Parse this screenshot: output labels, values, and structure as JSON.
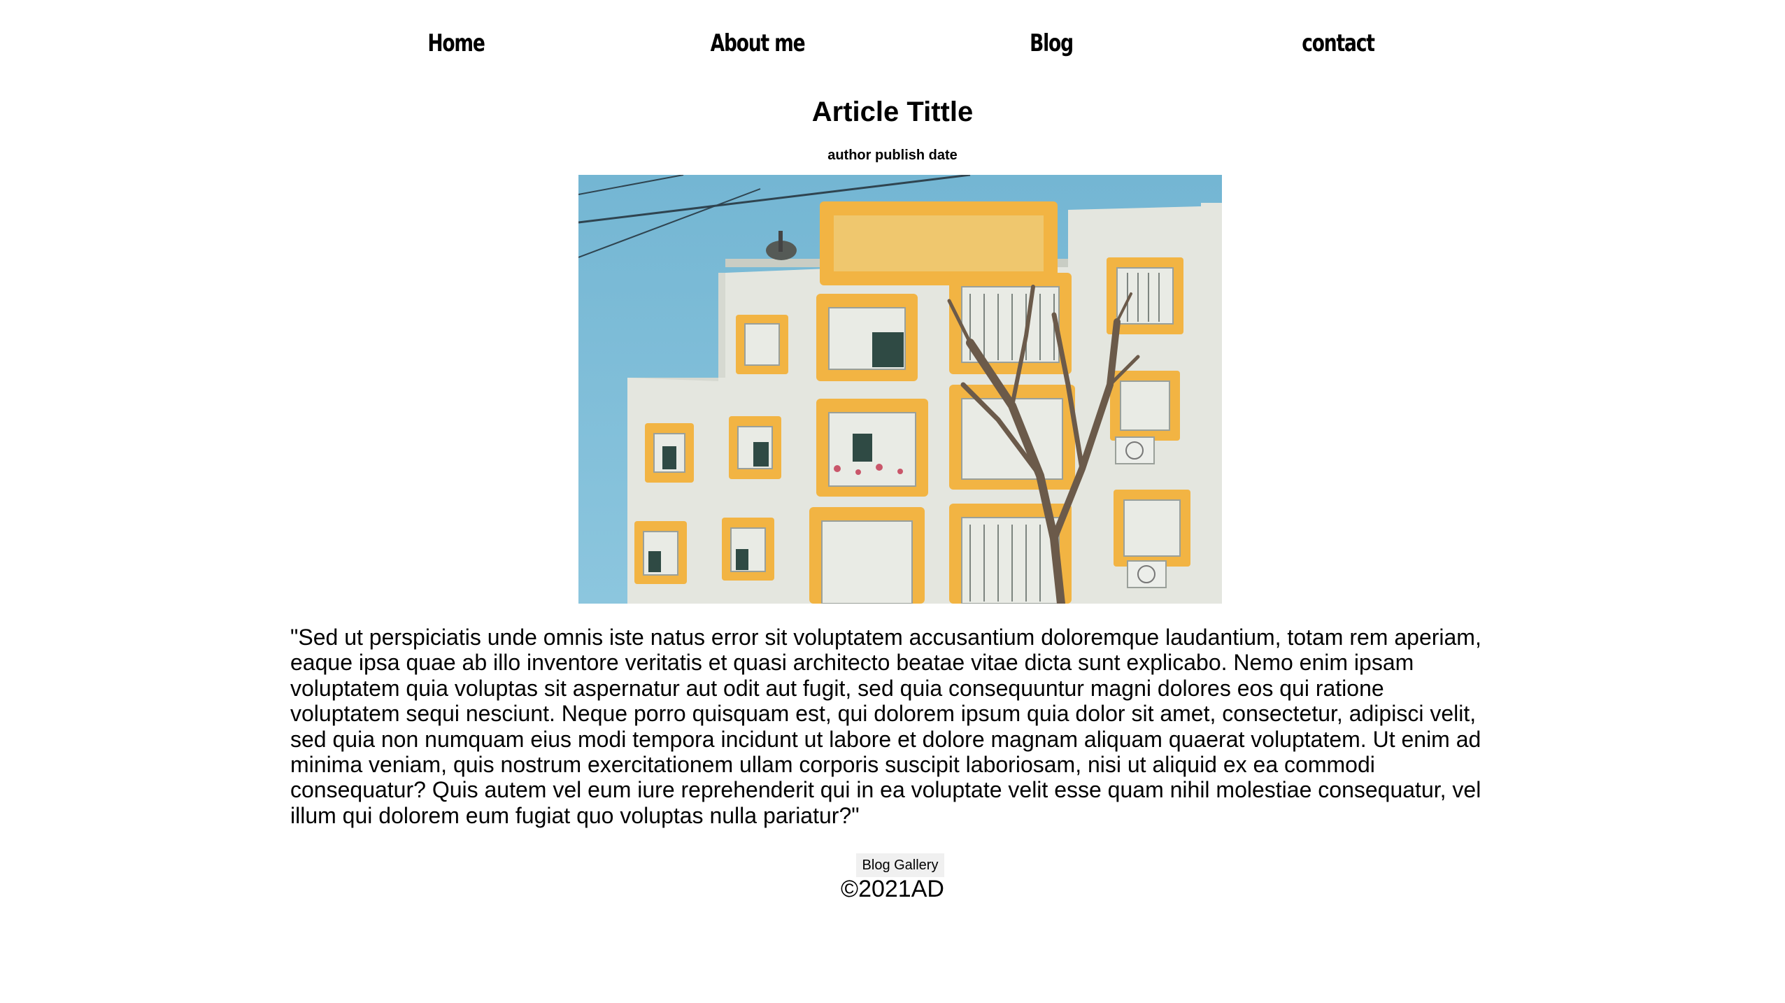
{
  "nav": {
    "items": [
      {
        "label": "Home"
      },
      {
        "label": "About me"
      },
      {
        "label": "Blog"
      },
      {
        "label": "contact"
      }
    ]
  },
  "article": {
    "title": "Article Tittle",
    "meta": "author publish date",
    "body": "\"Sed ut perspiciatis unde omnis iste natus error sit voluptatem accusantium doloremque laudantium, totam rem aperiam, eaque ipsa quae ab illo inventore veritatis et quasi architecto beatae vitae dicta sunt explicabo. Nemo enim ipsam voluptatem quia voluptas sit aspernatur aut odit aut fugit, sed quia consequuntur magni dolores eos qui ratione voluptatem sequi nesciunt. Neque porro quisquam est, qui dolorem ipsum quia dolor sit amet, consectetur, adipisci velit, sed quia non numquam eius modi tempora incidunt ut labore et dolore magnam aliquam quaerat voluptatem. Ut enim ad minima veniam, quis nostrum exercitationem ullam corporis suscipit laboriosam, nisi ut aliquid ex ea commodi consequatur? Quis autem vel eum iure reprehenderit qui in ea voluptate velit esse quam nihil molestiae consequatur, vel illum qui dolorem eum fugiat quo voluptas nulla pariatur?\""
  },
  "footer": {
    "gallery_button": "Blog Gallery",
    "copyright": "©2021AD"
  },
  "colors": {
    "sky": "#7dbbd6",
    "wall": "#e6e8e2",
    "frame": "#f2b443",
    "window": "#3d4a48",
    "tree": "#6b5a4a"
  }
}
